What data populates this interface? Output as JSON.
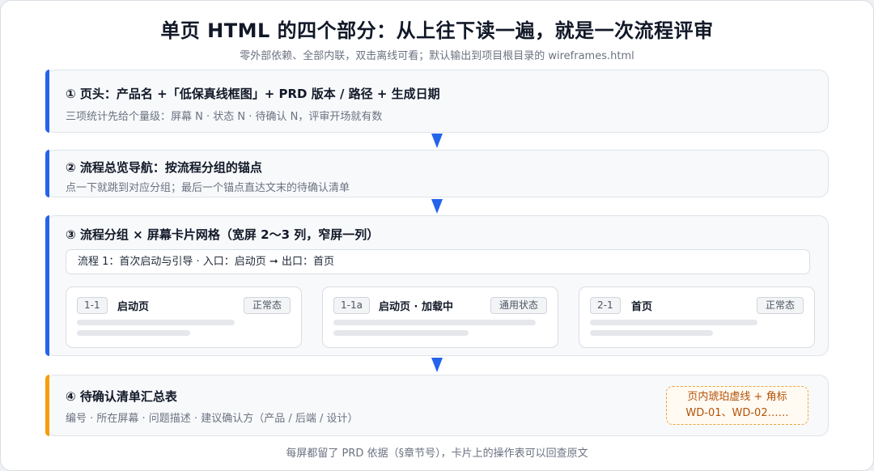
{
  "header": {
    "title": "单页 HTML 的四个部分：从上往下读一遍，就是一次流程评审",
    "subtitle": "零外部依赖、全部内联，双击离线可看；默认输出到项目根目录的 wireframes.html"
  },
  "sections": [
    {
      "title": "① 页头：产品名 +「低保真线框图」+ PRD 版本 / 路径 + 生成日期",
      "desc": "三项统计先给个量级：屏幕 N · 状态 N · 待确认 N，评审开场就有数"
    },
    {
      "title": "② 流程总览导航：按流程分组的锚点",
      "desc": "点一下就跳到对应分组；最后一个锚点直达文末的待确认清单"
    },
    {
      "title": "③ 流程分组 × 屏幕卡片网格（宽屏 2～3 列，窄屏一列）",
      "flow_row": "流程 1：首次启动与引导 · 入口：启动页 ➞ 出口：首页",
      "cards": [
        {
          "id": "1-1",
          "name": "启动页",
          "tag": "正常态"
        },
        {
          "id": "1-1a",
          "name": "启动页 · 加载中",
          "tag": "通用状态"
        },
        {
          "id": "2-1",
          "name": "首页",
          "tag": "正常态"
        }
      ]
    },
    {
      "title": "④ 待确认清单汇总表",
      "desc": "编号 · 所在屏幕 · 问题描述 · 建议确认方（产品 / 后端 / 设计）",
      "note_line1": "页内琥珀虚线 + 角标",
      "note_line2": "WD-01、WD-02……"
    }
  ],
  "footer": "每屏都留了 PRD 依据（§章节号），卡片上的操作表可以回查原文",
  "colors": {
    "accent_blue": "#2563eb",
    "accent_orange": "#f59e0b",
    "note_text": "#b45309"
  }
}
